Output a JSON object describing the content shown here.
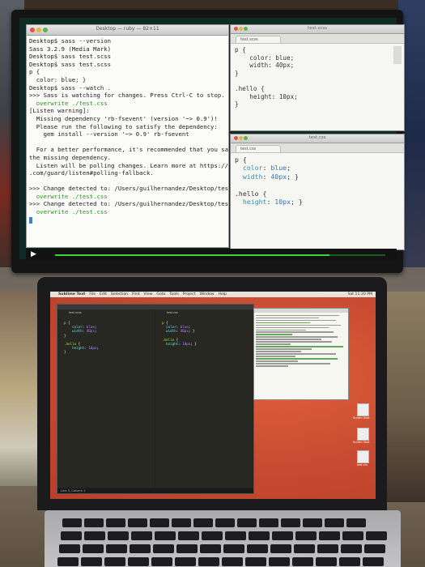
{
  "monitor": {
    "terminal": {
      "window_title": "Desktop — ruby — 82×11",
      "lines": [
        {
          "text": "Desktop$ sass --version"
        },
        {
          "text": "Sass 3.2.9 (Media Mark)"
        },
        {
          "text": "Desktop$ sass test.scss"
        },
        {
          "text": "Desktop$ sass test.scss"
        },
        {
          "text": "p {"
        },
        {
          "text": "  color: blue; }"
        },
        {
          "text": "Desktop$ sass --watch ."
        },
        {
          "text": ">>> Sass is watching for changes. Press Ctrl-C to stop."
        },
        {
          "text": "  overwrite ./test.css",
          "style": "green"
        },
        {
          "text": "[Listen warning]:"
        },
        {
          "text": "  Missing dependency 'rb-fsevent' (version '~> 0.9')!"
        },
        {
          "text": "  Please run the following to satisfy the dependency:"
        },
        {
          "text": "    gem install --version '~> 0.9' rb-fsevent"
        },
        {
          "text": ""
        },
        {
          "text": "  For a better performance, it's recommended that you satisfy"
        },
        {
          "text": "the missing dependency."
        },
        {
          "text": "  Listen will be polling changes. Learn more at https://github"
        },
        {
          "text": ".com/guard/listen#polling-fallback."
        },
        {
          "text": ""
        },
        {
          "text": ">>> Change detected to: /Users/guilhernandez/Desktop/test.scss"
        },
        {
          "text": "  overwrite ./test.css",
          "style": "green"
        },
        {
          "text": ">>> Change detected to: /Users/guilhernandez/Desktop/test.scss"
        },
        {
          "text": "  overwrite ./test.css",
          "style": "green"
        }
      ]
    },
    "scss_editor": {
      "window_title": "test.scss",
      "tab_label": "test.scss",
      "code": [
        {
          "t": "p {"
        },
        {
          "t": "    color: blue;"
        },
        {
          "t": "    width: 40px;"
        },
        {
          "t": "}"
        },
        {
          "t": ""
        },
        {
          "t": ".hello {"
        },
        {
          "t": "    height: 10px;"
        },
        {
          "t": "}"
        }
      ]
    },
    "css_editor": {
      "window_title": "test.css",
      "tab_label": "test.css",
      "code": [
        {
          "t": "p {"
        },
        {
          "t": "  color: blue;",
          "k": "color",
          "v": "blue"
        },
        {
          "t": "  width: 40px; }",
          "k": "width",
          "v": "40px"
        },
        {
          "t": ""
        },
        {
          "t": ".hello {"
        },
        {
          "t": "  height: 10px; }",
          "k": "height",
          "v": "10px"
        }
      ]
    },
    "player": {
      "progress": 0.83
    }
  },
  "laptop": {
    "menubar_items": [
      "Sublime Text",
      "File",
      "Edit",
      "Selection",
      "Find",
      "View",
      "Goto",
      "Tools",
      "Project",
      "Window",
      "Help"
    ],
    "clock": "Sat 11:20 PM",
    "sublime_tabs": [
      "test.scss",
      "test.css"
    ],
    "statusbar": "Line 3, Column 1",
    "desktop_icons": [
      "Screen Shot",
      "Screen Shot",
      "test.css"
    ]
  },
  "colors": {
    "terminal_green": "#2c9a24",
    "css_keyword": "#2c8fb0",
    "progress": "#3cd23c",
    "laptop_wallpaper": "#c9563a"
  }
}
